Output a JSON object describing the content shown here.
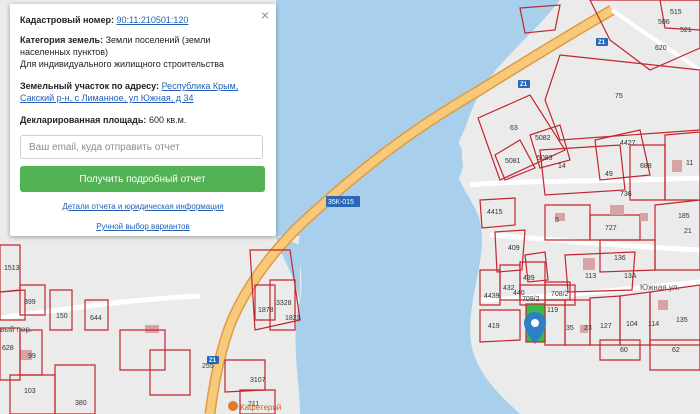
{
  "popup": {
    "cadastral_label": "Кадастровый номер:",
    "cadastral_value": "90:11:210501:120",
    "category_label": "Категория земель:",
    "category_value": "Земли поселений (земли населенных пунктов)",
    "category_use": "Для индивидуального жилищного строительства",
    "address_label": "Земельный участок по адресу:",
    "address_value": "Республика Крым, Сакский р-н, с Лиманное, ул Южная, д 34",
    "area_label": "Декларированная площадь:",
    "area_value": "600 кв.м.",
    "email_placeholder": "Ваш email, куда отправить отчет",
    "report_button": "Получить подробный отчет",
    "details_link": "Детали отчета и юридическая информация",
    "manual_link": "Ручной выбор вариантов",
    "close": "×"
  },
  "map": {
    "colors": {
      "water": "#a8d0ed",
      "land": "#ebebeb",
      "parcel": "#c2262e",
      "road": "#f3b45c",
      "road_edge": "#e19a3c",
      "building": "#d8a3a3",
      "selected": "#3cb84a",
      "pin": "#2f7fc4"
    },
    "road_labels": [
      "35К-015",
      "Южная ул."
    ],
    "street_labels": [
      "вый пер."
    ],
    "poi_labels": [
      "Кафетерий"
    ],
    "route_shields": [
      "Z1",
      "Z1",
      "Z1"
    ],
    "parcel_numbers": [
      "515",
      "521",
      "506",
      "620",
      "75",
      "63",
      "5082",
      "5081",
      "5083",
      "4427",
      "14",
      "688",
      "49",
      "736",
      "11",
      "4415",
      "5",
      "727",
      "185",
      "21",
      "409",
      "136",
      "113",
      "13А",
      "4439",
      "432",
      "439",
      "440",
      "709/2",
      "708/2",
      "419",
      "119",
      "35",
      "23",
      "127",
      "104",
      "114",
      "135",
      "60",
      "62",
      "255",
      "3328",
      "1878",
      "1823",
      "3107",
      "211",
      "380",
      "103",
      "99",
      "399",
      "150",
      "644",
      "628",
      "1513"
    ],
    "shop_label": "255",
    "area_label_right": "Кафетерий"
  }
}
